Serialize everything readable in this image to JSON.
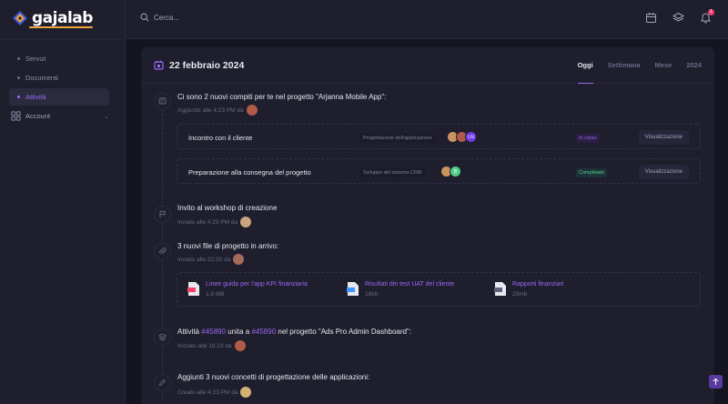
{
  "brand": {
    "name": "gajalab"
  },
  "sidebar": {
    "items": [
      {
        "label": "Servizi"
      },
      {
        "label": "Documenti"
      },
      {
        "label": "Attività"
      },
      {
        "label": "Account"
      }
    ]
  },
  "header": {
    "search_placeholder": "Cerca...",
    "notification_count": "1"
  },
  "card": {
    "title": "22 febbraio 2024",
    "tabs": [
      {
        "label": "Oggi"
      },
      {
        "label": "Settimana"
      },
      {
        "label": "Mese"
      },
      {
        "label": "2024"
      }
    ]
  },
  "timeline": {
    "e1": {
      "title": "Ci sono 2 nuovi compiti per te nel progetto \"Arjanna Mobile App\":",
      "meta": "Aggiunto alle 4:23 PM da",
      "tasks": [
        {
          "name": "Incontro con il cliente",
          "project": "Progettazione dell'applicazione",
          "status": "In corso",
          "action": "Visualizzazione",
          "avatar_initials": "LN"
        },
        {
          "name": "Preparazione alla consegna del progetto",
          "project": "Sviluppo del sistema CRM",
          "status": "Completato",
          "action": "Visualizzazione",
          "avatar_initials": "B"
        }
      ]
    },
    "e2": {
      "title": "Invito al workshop di creazione",
      "meta": "Inviato alle 4:23 PM da"
    },
    "e3": {
      "title": "3 nuovi file di progetto in arrivo:",
      "meta": "Inviato alle 22:30 da",
      "files": [
        {
          "name": "Linee guida per l'app KPI finanziaria",
          "size": "1,9 MB",
          "type": "PDF"
        },
        {
          "name": "Risultati dei test UAT del cliente",
          "size": "18kb",
          "type": "DOC"
        },
        {
          "name": "Rapporti finanziari",
          "size": "20mb",
          "type": "CSS"
        }
      ]
    },
    "e4": {
      "prefix": "Attività",
      "ref1": "#45890",
      "mid": "unita a",
      "ref2": "#45890",
      "suffix": "nel progetto \"Ads Pro Admin Dashboard\":",
      "meta": "Iniziato alle 16:23 da"
    },
    "e5": {
      "title": "Aggiunti 3 nuovi concetti di progettazione delle applicazioni:",
      "meta": "Creato alle 4:23 PM da"
    }
  },
  "colors": {
    "accent": "#9b68f5",
    "success": "#50cd89",
    "danger": "#f1416c",
    "brand_underline": "#f1a33a"
  }
}
